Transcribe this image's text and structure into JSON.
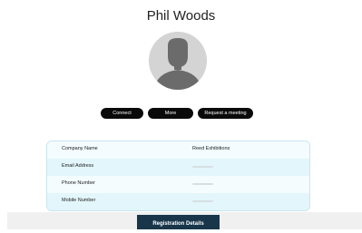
{
  "profile": {
    "name": "Phil Woods",
    "avatar_icon": "person-silhouette-icon"
  },
  "actions": {
    "connect_label": "Connect",
    "more_label": "More",
    "request_meeting_label": "Request a meeting"
  },
  "details": {
    "rows": [
      {
        "label": "Company Name",
        "value": "Reed Exhibitions"
      },
      {
        "label": "Email Address",
        "value": ""
      },
      {
        "label": "Phone Number",
        "value": ""
      },
      {
        "label": "Mobile Number",
        "value": ""
      }
    ]
  },
  "footer": {
    "registration_details_label": "Registration Details"
  },
  "colors": {
    "button_dark": "#0a0a0a",
    "card_background": "#f4fcfe",
    "card_row_alt": "#e2f6fb",
    "registration_button": "#18354a"
  }
}
